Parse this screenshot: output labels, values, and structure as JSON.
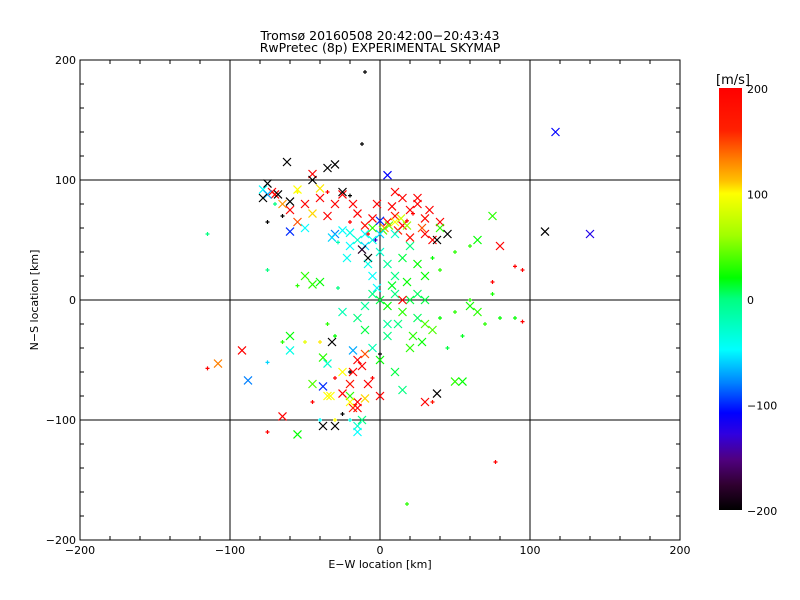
{
  "chart_data": {
    "type": "scatter",
    "title": "Tromsø 20160508 20:42:00−20:43:43",
    "subtitle": "RwPretec (8p) EXPERIMENTAL SKYMAP",
    "xlabel": "E−W location [km]",
    "ylabel": "N−S location [km]",
    "xlim": [
      -200,
      200
    ],
    "ylim": [
      -200,
      200
    ],
    "xticks": [
      -200,
      -100,
      0,
      100,
      200
    ],
    "yticks": [
      -200,
      -100,
      0,
      100,
      200
    ],
    "xtick_labels": [
      "−200",
      "−100",
      "0",
      "100",
      "200"
    ],
    "ytick_labels": [
      "−200",
      "−100",
      "0",
      "100",
      "200"
    ],
    "grid_lines": [
      -100,
      0,
      100
    ],
    "colorbar": {
      "label": "[m/s]",
      "range": [
        -200,
        200
      ],
      "ticks": [
        200,
        100,
        0,
        -100,
        -200
      ],
      "tick_labels": [
        "200",
        "100",
        "0",
        "−100",
        "−200"
      ]
    },
    "point_fields": [
      "x_km",
      "y_km",
      "velocity_m_s",
      "marker (1=cross, 0=tick)"
    ],
    "points": [
      [
        5,
        65,
        200,
        1
      ],
      [
        10,
        70,
        190,
        1
      ],
      [
        15,
        62,
        200,
        1
      ],
      [
        20,
        75,
        200,
        1
      ],
      [
        25,
        80,
        200,
        1
      ],
      [
        30,
        68,
        195,
        1
      ],
      [
        12,
        58,
        180,
        1
      ],
      [
        18,
        66,
        200,
        0
      ],
      [
        22,
        72,
        200,
        0
      ],
      [
        28,
        60,
        170,
        1
      ],
      [
        8,
        78,
        200,
        1
      ],
      [
        33,
        75,
        200,
        1
      ],
      [
        3,
        60,
        150,
        1
      ],
      [
        15,
        85,
        200,
        1
      ],
      [
        -5,
        68,
        200,
        1
      ],
      [
        -10,
        62,
        190,
        1
      ],
      [
        -15,
        72,
        200,
        1
      ],
      [
        -20,
        65,
        200,
        0
      ],
      [
        -30,
        80,
        200,
        1
      ],
      [
        -40,
        85,
        200,
        1
      ],
      [
        -50,
        80,
        200,
        1
      ],
      [
        -60,
        75,
        200,
        1
      ],
      [
        -55,
        65,
        170,
        1
      ],
      [
        -70,
        88,
        200,
        1
      ],
      [
        -72,
        90,
        200,
        1
      ],
      [
        -35,
        90,
        200,
        0
      ],
      [
        -25,
        88,
        200,
        1
      ],
      [
        -45,
        105,
        200,
        1
      ],
      [
        -65,
        80,
        150,
        1
      ],
      [
        30,
        55,
        200,
        1
      ],
      [
        35,
        50,
        200,
        1
      ],
      [
        40,
        65,
        200,
        1
      ],
      [
        -8,
        55,
        200,
        0
      ],
      [
        20,
        52,
        190,
        1
      ],
      [
        25,
        85,
        200,
        1
      ],
      [
        10,
        90,
        200,
        1
      ],
      [
        -2,
        80,
        200,
        1
      ],
      [
        -18,
        80,
        200,
        1
      ],
      [
        10,
        65,
        100,
        1
      ],
      [
        14,
        68,
        80,
        1
      ],
      [
        6,
        62,
        50,
        1
      ],
      [
        2,
        58,
        40,
        1
      ],
      [
        18,
        62,
        60,
        1
      ],
      [
        -5,
        60,
        30,
        1
      ],
      [
        -20,
        56,
        -40,
        1
      ],
      [
        -25,
        58,
        -50,
        1
      ],
      [
        -15,
        50,
        -30,
        1
      ],
      [
        -10,
        45,
        -60,
        1
      ],
      [
        -30,
        55,
        -80,
        1
      ],
      [
        0,
        66,
        -100,
        1
      ],
      [
        5,
        104,
        -110,
        1
      ],
      [
        -3,
        50,
        -130,
        0
      ],
      [
        -12,
        42,
        -180,
        1
      ],
      [
        -8,
        35,
        -200,
        1
      ],
      [
        -22,
        35,
        -45,
        1
      ],
      [
        -28,
        48,
        -20,
        0
      ],
      [
        -50,
        60,
        -50,
        1
      ],
      [
        -60,
        57,
        -100,
        1
      ],
      [
        -78,
        92,
        -50,
        1
      ],
      [
        -75,
        88,
        -70,
        1
      ],
      [
        -70,
        80,
        0,
        0
      ],
      [
        -45,
        72,
        120,
        1
      ],
      [
        -40,
        93,
        110,
        1
      ],
      [
        -55,
        90,
        100,
        0
      ],
      [
        -62,
        115,
        -200,
        1
      ],
      [
        -35,
        110,
        -200,
        1
      ],
      [
        -30,
        113,
        -200,
        1
      ],
      [
        -75,
        97,
        -200,
        1
      ],
      [
        -78,
        85,
        -200,
        1
      ],
      [
        -68,
        88,
        -200,
        1
      ],
      [
        -60,
        82,
        -200,
        1
      ],
      [
        -65,
        70,
        -200,
        0
      ],
      [
        -75,
        65,
        -200,
        0
      ],
      [
        -45,
        100,
        -200,
        1
      ],
      [
        -25,
        90,
        -200,
        1
      ],
      [
        -20,
        87,
        -200,
        0
      ],
      [
        -10,
        190,
        -200,
        0
      ],
      [
        -12,
        130,
        -200,
        0
      ],
      [
        38,
        50,
        -200,
        1
      ],
      [
        45,
        55,
        -200,
        1
      ],
      [
        110,
        57,
        -200,
        1
      ],
      [
        -30,
        -105,
        -200,
        1
      ],
      [
        -38,
        -105,
        -200,
        1
      ],
      [
        -32,
        -35,
        -200,
        1
      ],
      [
        38,
        -78,
        -200,
        1
      ],
      [
        -20,
        -60,
        -200,
        0
      ],
      [
        -25,
        -95,
        -200,
        0
      ],
      [
        0,
        -45,
        -200,
        0
      ],
      [
        0,
        0,
        10,
        1
      ],
      [
        5,
        -5,
        20,
        1
      ],
      [
        10,
        5,
        0,
        1
      ],
      [
        15,
        -10,
        30,
        1
      ],
      [
        20,
        0,
        10,
        1
      ],
      [
        25,
        -15,
        5,
        1
      ],
      [
        30,
        -20,
        40,
        1
      ],
      [
        -5,
        5,
        0,
        1
      ],
      [
        -10,
        -5,
        -10,
        1
      ],
      [
        8,
        12,
        15,
        1
      ],
      [
        18,
        15,
        20,
        1
      ],
      [
        12,
        -20,
        0,
        1
      ],
      [
        22,
        -30,
        30,
        1
      ],
      [
        28,
        -35,
        20,
        1
      ],
      [
        35,
        -25,
        40,
        1
      ],
      [
        5,
        -30,
        0,
        1
      ],
      [
        0,
        -50,
        20,
        1
      ],
      [
        10,
        -60,
        10,
        1
      ],
      [
        15,
        -75,
        0,
        1
      ],
      [
        20,
        -40,
        30,
        1
      ],
      [
        40,
        -15,
        20,
        0
      ],
      [
        50,
        -10,
        30,
        0
      ],
      [
        60,
        -5,
        25,
        1
      ],
      [
        65,
        -10,
        30,
        1
      ],
      [
        70,
        -20,
        30,
        0
      ],
      [
        80,
        -15,
        20,
        0
      ],
      [
        55,
        -30,
        15,
        0
      ],
      [
        45,
        -40,
        10,
        0
      ],
      [
        50,
        -68,
        30,
        1
      ],
      [
        55,
        -68,
        20,
        1
      ],
      [
        60,
        0,
        30,
        0
      ],
      [
        75,
        5,
        25,
        0
      ],
      [
        90,
        -15,
        20,
        0
      ],
      [
        10,
        20,
        0,
        1
      ],
      [
        5,
        30,
        -10,
        1
      ],
      [
        15,
        35,
        10,
        1
      ],
      [
        25,
        30,
        20,
        1
      ],
      [
        30,
        20,
        20,
        1
      ],
      [
        0,
        40,
        -30,
        1
      ],
      [
        20,
        45,
        0,
        1
      ],
      [
        35,
        35,
        20,
        0
      ],
      [
        40,
        25,
        30,
        0
      ],
      [
        50,
        40,
        30,
        0
      ],
      [
        60,
        45,
        30,
        0
      ],
      [
        65,
        50,
        20,
        1
      ],
      [
        75,
        70,
        30,
        1
      ],
      [
        -40,
        15,
        20,
        1
      ],
      [
        -45,
        13,
        30,
        1
      ],
      [
        -50,
        20,
        30,
        1
      ],
      [
        -55,
        12,
        30,
        0
      ],
      [
        -38,
        -48,
        30,
        1
      ],
      [
        -60,
        -30,
        20,
        1
      ],
      [
        -65,
        -35,
        30,
        0
      ],
      [
        -45,
        -70,
        40,
        1
      ],
      [
        -55,
        -112,
        20,
        1
      ],
      [
        -15,
        -105,
        -30,
        1
      ],
      [
        -12,
        -100,
        0,
        1
      ],
      [
        -20,
        -80,
        30,
        1
      ],
      [
        -30,
        -30,
        20,
        0
      ],
      [
        -35,
        -20,
        30,
        0
      ],
      [
        -25,
        -10,
        -20,
        1
      ],
      [
        -15,
        -15,
        0,
        1
      ],
      [
        -5,
        -40,
        -20,
        1
      ],
      [
        -10,
        -25,
        10,
        1
      ],
      [
        5,
        -20,
        -10,
        1
      ],
      [
        25,
        5,
        5,
        1
      ],
      [
        30,
        0,
        10,
        1
      ],
      [
        -115,
        55,
        0,
        0
      ],
      [
        18,
        -170,
        30,
        0
      ],
      [
        40,
        60,
        30,
        1
      ],
      [
        -75,
        25,
        0,
        0
      ],
      [
        -15,
        -50,
        200,
        1
      ],
      [
        -12,
        -55,
        200,
        1
      ],
      [
        -10,
        -45,
        170,
        1
      ],
      [
        -18,
        -60,
        200,
        1
      ],
      [
        -8,
        -70,
        200,
        1
      ],
      [
        -20,
        -70,
        190,
        1
      ],
      [
        -25,
        -78,
        200,
        1
      ],
      [
        -30,
        -65,
        200,
        0
      ],
      [
        -15,
        -85,
        200,
        1
      ],
      [
        -18,
        -90,
        180,
        1
      ],
      [
        -5,
        -65,
        200,
        0
      ],
      [
        0,
        -80,
        200,
        1
      ],
      [
        -10,
        -82,
        120,
        1
      ],
      [
        -20,
        -85,
        100,
        1
      ],
      [
        -35,
        -80,
        100,
        1
      ],
      [
        30,
        -85,
        200,
        1
      ],
      [
        35,
        -85,
        190,
        0
      ],
      [
        -45,
        -85,
        200,
        0
      ],
      [
        -65,
        -97,
        200,
        1
      ],
      [
        -75,
        -110,
        200,
        0
      ],
      [
        -115,
        -57,
        200,
        0
      ],
      [
        -108,
        -53,
        160,
        1
      ],
      [
        -92,
        -42,
        200,
        1
      ],
      [
        -35,
        70,
        200,
        1
      ],
      [
        77,
        -135,
        200,
        0
      ],
      [
        80,
        45,
        200,
        1
      ],
      [
        90,
        28,
        200,
        0
      ],
      [
        95,
        25,
        200,
        0
      ],
      [
        75,
        15,
        200,
        0
      ],
      [
        95,
        -18,
        200,
        0
      ],
      [
        15,
        0,
        200,
        1
      ],
      [
        -15,
        -90,
        200,
        1
      ],
      [
        117,
        140,
        -110,
        1
      ],
      [
        140,
        55,
        -120,
        1
      ],
      [
        -38,
        -72,
        -100,
        1
      ],
      [
        -75,
        -52,
        -60,
        0
      ],
      [
        -88,
        -67,
        -80,
        1
      ],
      [
        -35,
        -53,
        -30,
        1
      ],
      [
        -18,
        -42,
        -70,
        1
      ],
      [
        -28,
        10,
        0,
        0
      ],
      [
        -15,
        -110,
        -50,
        1
      ],
      [
        -20,
        -100,
        -40,
        0
      ],
      [
        -5,
        20,
        -50,
        1
      ],
      [
        -2,
        10,
        -50,
        1
      ],
      [
        -8,
        30,
        -40,
        1
      ],
      [
        -20,
        45,
        -50,
        1
      ],
      [
        -10,
        55,
        -50,
        1
      ],
      [
        -5,
        50,
        -40,
        1
      ],
      [
        0,
        55,
        -60,
        1
      ],
      [
        10,
        55,
        -30,
        1
      ],
      [
        -32,
        52,
        -60,
        1
      ],
      [
        -40,
        -100,
        -50,
        0
      ],
      [
        -60,
        -42,
        -40,
        1
      ],
      [
        -33,
        -80,
        100,
        1
      ],
      [
        -30,
        -100,
        100,
        0
      ],
      [
        -50,
        -35,
        90,
        0
      ],
      [
        -40,
        -35,
        110,
        0
      ],
      [
        -55,
        92,
        100,
        1
      ],
      [
        -25,
        -60,
        100,
        1
      ]
    ]
  }
}
